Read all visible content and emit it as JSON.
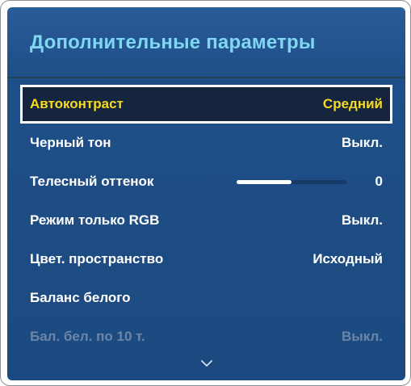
{
  "menu": {
    "title": "Дополнительные параметры",
    "items": [
      {
        "label": "Автоконтраст",
        "value": "Средний",
        "state": "selected"
      },
      {
        "label": "Черный тон",
        "value": "Выкл.",
        "state": "normal"
      },
      {
        "label": "Телесный оттенок",
        "value": "0",
        "state": "normal",
        "slider_fraction": 0.5
      },
      {
        "label": "Режим только RGB",
        "value": "Выкл.",
        "state": "normal"
      },
      {
        "label": "Цвет. пространство",
        "value": "Исходный",
        "state": "normal"
      },
      {
        "label": "Баланс белого",
        "value": "",
        "state": "normal"
      },
      {
        "label": "Бал. бел. по 10 т.",
        "value": "Выкл.",
        "state": "disabled"
      }
    ]
  },
  "icons": {
    "scroll_down": "chevron-down-icon"
  },
  "colors": {
    "title": "#7fd7f2",
    "selected_text": "#f7d91f",
    "item_text": "#ffffff",
    "disabled_text": "#6b85a8",
    "panel_background": "#1f4f88",
    "selected_background": "#14253d"
  }
}
